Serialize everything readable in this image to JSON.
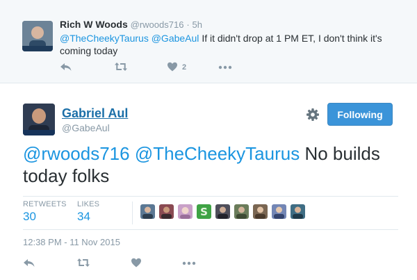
{
  "reply": {
    "name": "Rich W Woods",
    "handle": "@rwoods716",
    "separator": "·",
    "time": "5h",
    "mention1": "@TheCheekyTaurus",
    "mention2": "@GabeAul",
    "text": "If it didn't drop at 1 PM ET, I don't think it's coming today",
    "likes": "2"
  },
  "tweet": {
    "name": "Gabriel Aul",
    "handle": "@GabeAul",
    "follow_label": "Following",
    "mention1": "@rwoods716",
    "mention2": "@TheCheekyTaurus",
    "text": "No builds today folks",
    "retweets_label": "RETWEETS",
    "retweets": "30",
    "likes_label": "LIKES",
    "likes": "34",
    "timestamp": "12:38 PM - 11 Nov 2015"
  },
  "colors": {
    "link": "#1b95e0",
    "follow_button": "#3b94d9",
    "icon_gray": "#8899a6",
    "reply_background": "#f5f8fa"
  },
  "icons": [
    "reply-icon",
    "retweet-icon",
    "heart-icon",
    "more-icon",
    "gear-icon"
  ],
  "likers": [
    {
      "color": "#5b7894"
    },
    {
      "color": "#8a4a52"
    },
    {
      "color": "#c9a0c8"
    },
    {
      "color": "#3fa345"
    },
    {
      "color": "#4e4e5a"
    },
    {
      "color": "#6a7c5a"
    },
    {
      "color": "#7a6652"
    },
    {
      "color": "#7386b5"
    },
    {
      "color": "#3f6d84"
    }
  ]
}
